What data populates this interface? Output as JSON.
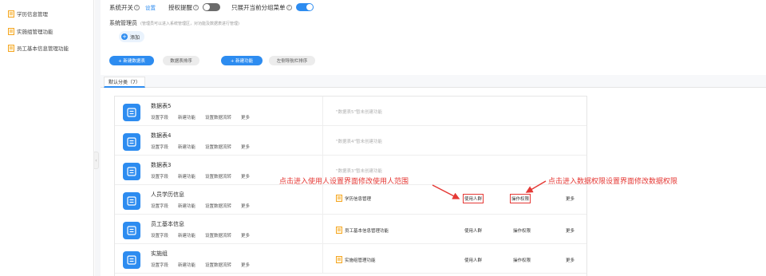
{
  "sidebar": {
    "items": [
      {
        "label": "学历信息管理"
      },
      {
        "label": "实施组管理功能"
      },
      {
        "label": "员工基本信息管理功能"
      }
    ]
  },
  "header": {
    "system_switch": "系统开关",
    "setting_link": "设置",
    "auth_reminder": "授权提醒",
    "expand_group_menu": "只展开当前分组菜单",
    "help_mark": "?"
  },
  "admin": {
    "label": "系统管理员",
    "hint": "(管理员可以进入系统管理区，对功能及数据表进行管理)",
    "add_label": "添加"
  },
  "toolbar": {
    "new_table": "+ 新建数据表",
    "sort_tables": "数据表排序",
    "new_function": "+ 新建功能",
    "nav_sort": "左侧导航栏排序"
  },
  "tab": {
    "label": "默认分类（7）"
  },
  "row_actions": {
    "set_fields": "设置字段",
    "new_function": "新建功能",
    "data_flow": "设置数据流转",
    "more": "更多",
    "users": "使用人群",
    "permissions": "操作权限"
  },
  "rows": [
    {
      "title": "数据表5",
      "note": "\"数据表5\"暂未创建功能"
    },
    {
      "title": "数据表4",
      "note": "\"数据表4\"暂未创建功能"
    },
    {
      "title": "数据表3",
      "note": "\"数据表3\"暂未创建功能"
    },
    {
      "title": "人员学历信息",
      "menu": "学历信息管理"
    },
    {
      "title": "员工基本信息",
      "menu": "员工基本信息管理功能"
    },
    {
      "title": "实施组",
      "menu": "实施组管理功能"
    }
  ],
  "annotations": {
    "left": "点击进入使用人设置界面修改使用人范围",
    "right": "点击进入数据权限设置界面修改数据权限"
  },
  "colors": {
    "accent": "#2d8cf0",
    "annotation": "#e53935",
    "toggle_off": "#6b6b6b"
  },
  "icons": {
    "sidebar": "folder-doc-icon",
    "app": "form-list-icon",
    "annotation": "red-arrow-icon"
  },
  "toggles": {
    "auth_reminder": false,
    "expand_group_menu": true
  }
}
